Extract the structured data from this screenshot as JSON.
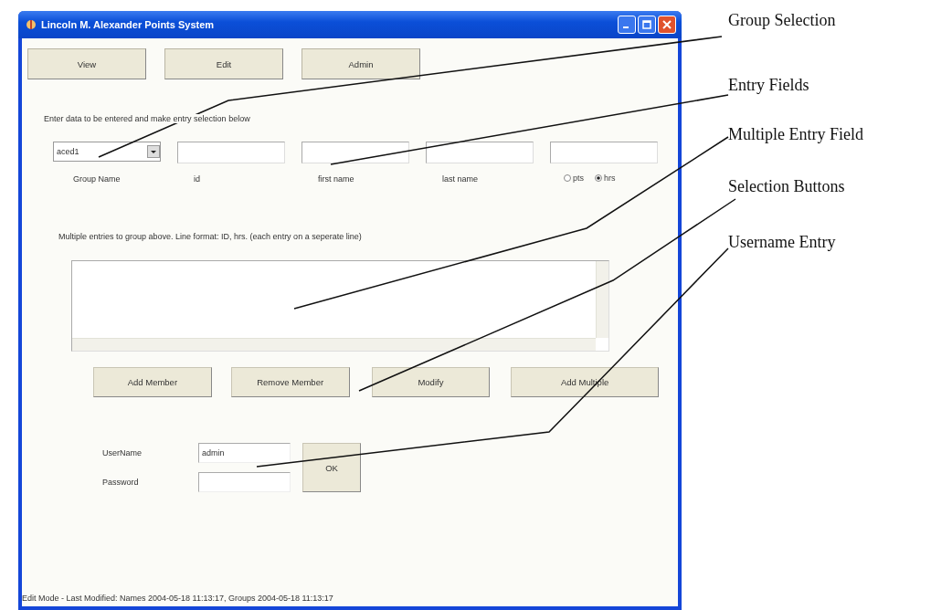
{
  "window": {
    "title": "Lincoln M. Alexander Points System"
  },
  "mode_buttons": [
    {
      "label": "View"
    },
    {
      "label": "Edit"
    },
    {
      "label": "Admin"
    }
  ],
  "instruction": "Enter data to be entered and make entry selection below",
  "group_select": {
    "value": "aced1",
    "label": "Group Name"
  },
  "entry_fields": [
    {
      "label": "id"
    },
    {
      "label": "first name"
    },
    {
      "label": "last name"
    }
  ],
  "unit_options": [
    {
      "label": "pts",
      "selected": false
    },
    {
      "label": "hrs",
      "selected": true
    }
  ],
  "multiple_entry": {
    "instruction": "Multiple entries to group above.  Line format: ID, hrs. (each entry on a seperate line)"
  },
  "action_buttons": [
    {
      "label": "Add Member"
    },
    {
      "label": "Remove Member"
    },
    {
      "label": "Modify"
    },
    {
      "label": "Add Multiple"
    }
  ],
  "login": {
    "username_label": "UserName",
    "username_value": "admin",
    "password_label": "Password",
    "ok_button": "OK"
  },
  "status_bar": "Edit Mode - Last Modified: Names 2004-05-18 11:13:17, Groups 2004-05-18 11:13:17",
  "annotations": [
    {
      "text": "Group Selection"
    },
    {
      "text": "Entry Fields"
    },
    {
      "text": "Multiple Entry Field"
    },
    {
      "text": "Selection Buttons"
    },
    {
      "text": "Username Entry"
    }
  ]
}
